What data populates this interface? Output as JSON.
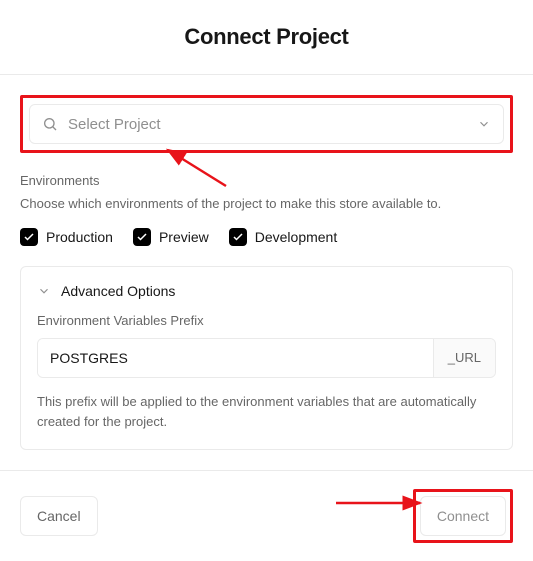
{
  "header": {
    "title": "Connect Project"
  },
  "project_select": {
    "placeholder": "Select Project"
  },
  "environments": {
    "label": "Environments",
    "description": "Choose which environments of the project to make this store available to.",
    "items": [
      {
        "label": "Production",
        "checked": true
      },
      {
        "label": "Preview",
        "checked": true
      },
      {
        "label": "Development",
        "checked": true
      }
    ]
  },
  "advanced": {
    "title": "Advanced Options",
    "field_label": "Environment Variables Prefix",
    "prefix_value": "POSTGRES",
    "suffix": "_URL",
    "description": "This prefix will be applied to the environment variables that are automatically created for the project."
  },
  "footer": {
    "cancel_label": "Cancel",
    "connect_label": "Connect"
  },
  "annotation": {
    "highlight_color": "#e8131a"
  }
}
